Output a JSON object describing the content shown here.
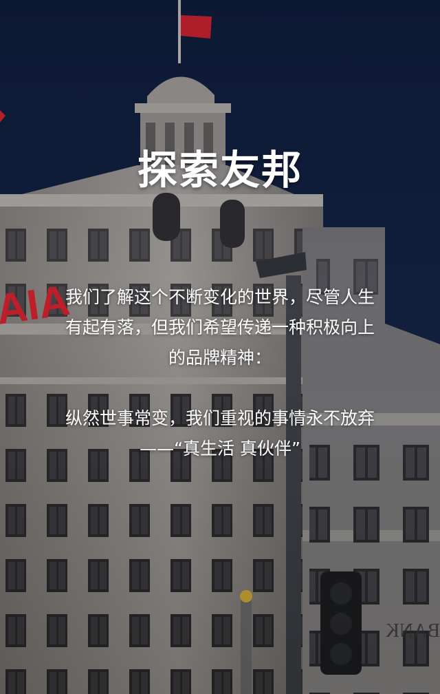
{
  "colors": {
    "sky": "#0f1b33",
    "building": "#8e8a86",
    "text": "#ffffff",
    "flag": "#c8202a",
    "logo": "#c8202a"
  },
  "hero": {
    "title": "探索友邦",
    "logo_text": "AIA",
    "bank_sign": "BANK",
    "paragraph1_line1": "我们了解这个不断变化的世界，尽管人生",
    "paragraph1_line2": "有起有落，但我们希望传递一种积极向上",
    "paragraph1_line3": "的品牌精神：",
    "paragraph2_line1": "纵然世事常变，我们重视的事情永不放弃",
    "paragraph2_line2": "——“真生活 真伙伴”"
  }
}
